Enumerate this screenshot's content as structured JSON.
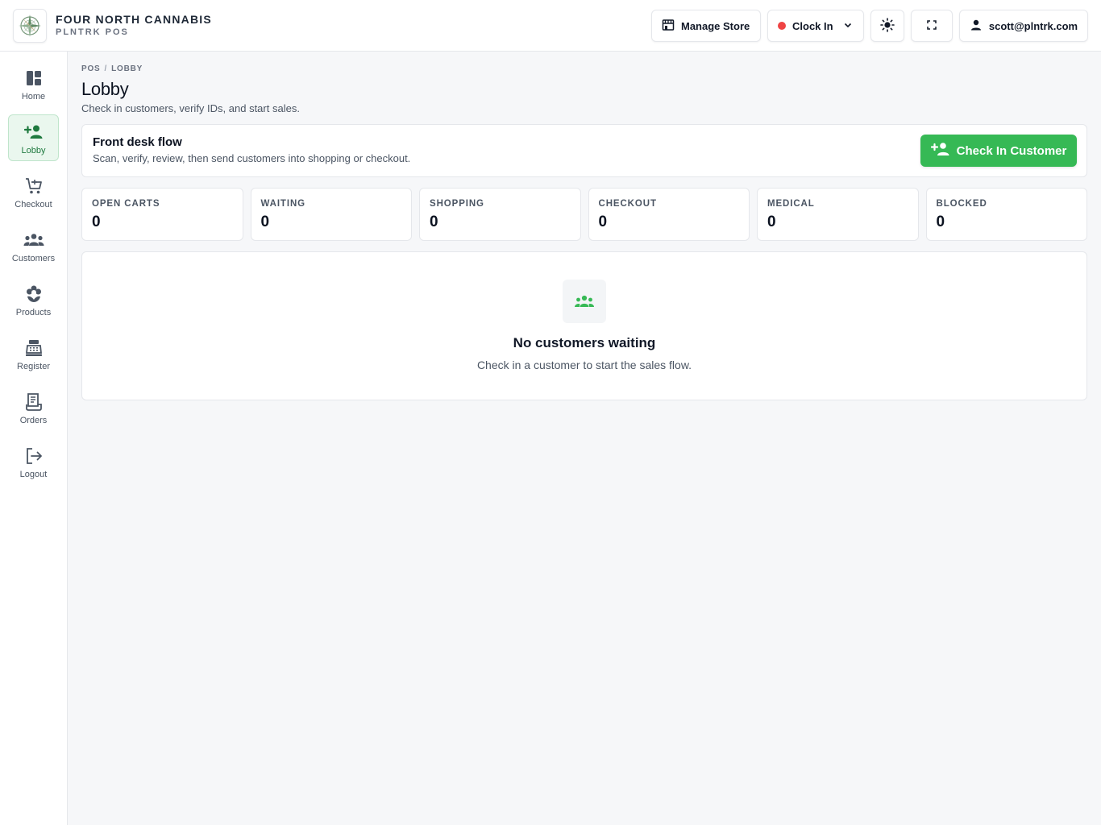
{
  "brand": {
    "name": "FOUR NORTH CANNABIS",
    "subtitle": "PLNTRK POS"
  },
  "header": {
    "manage_store": "Manage Store",
    "clock_in": "Clock In",
    "clock_status_color": "#ef4444",
    "user_email": "scott@plntrk.com"
  },
  "sidebar": {
    "items": [
      {
        "label": "Home",
        "icon": "dashboard-icon"
      },
      {
        "label": "Lobby",
        "icon": "person-add-icon",
        "active": true
      },
      {
        "label": "Checkout",
        "icon": "cart-icon"
      },
      {
        "label": "Customers",
        "icon": "people-icon"
      },
      {
        "label": "Products",
        "icon": "flower-icon"
      },
      {
        "label": "Register",
        "icon": "register-icon"
      },
      {
        "label": "Orders",
        "icon": "receipt-icon"
      },
      {
        "label": "Logout",
        "icon": "logout-icon"
      }
    ]
  },
  "breadcrumb": {
    "root": "POS",
    "current": "LOBBY"
  },
  "page": {
    "title": "Lobby",
    "subtitle": "Check in customers, verify IDs, and start sales."
  },
  "flow": {
    "title": "Front desk flow",
    "subtitle": "Scan, verify, review, then send customers into shopping or checkout.",
    "button": "Check In Customer"
  },
  "stats": [
    {
      "label": "OPEN CARTS",
      "value": "0"
    },
    {
      "label": "WAITING",
      "value": "0"
    },
    {
      "label": "SHOPPING",
      "value": "0"
    },
    {
      "label": "CHECKOUT",
      "value": "0"
    },
    {
      "label": "MEDICAL",
      "value": "0"
    },
    {
      "label": "BLOCKED",
      "value": "0"
    }
  ],
  "empty": {
    "title": "No customers waiting",
    "subtitle": "Check in a customer to start the sales flow."
  },
  "colors": {
    "accent": "#36b955",
    "active_nav_bg": "#eaf7ee",
    "active_nav_text": "#1f7a3f"
  }
}
